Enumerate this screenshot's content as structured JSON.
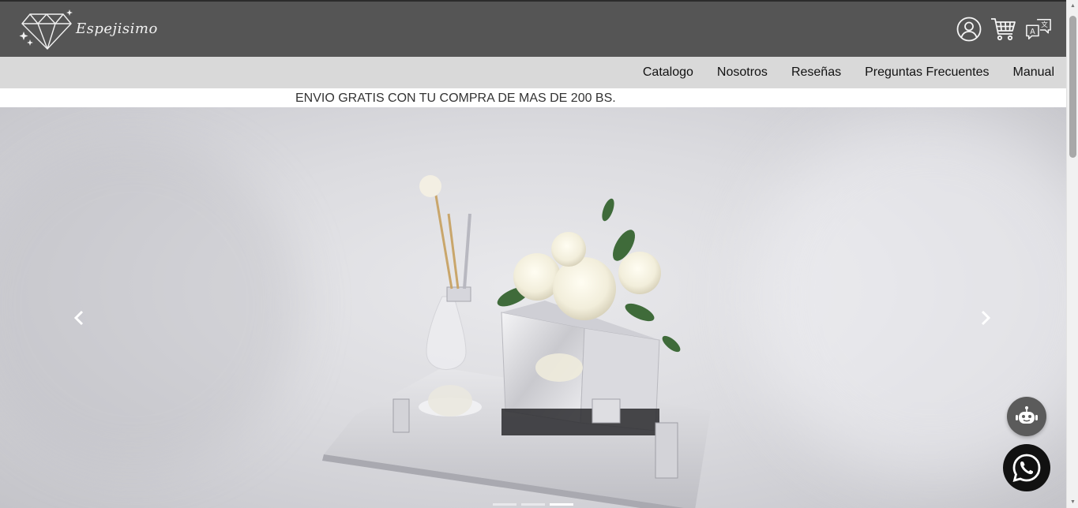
{
  "header": {
    "logo_text": "Espejisimo",
    "icons": [
      "user-account-icon",
      "shopping-cart-icon",
      "translate-icon"
    ]
  },
  "nav": {
    "items": [
      {
        "label": "Catalogo"
      },
      {
        "label": "Nosotros"
      },
      {
        "label": "Reseñas"
      },
      {
        "label": "Preguntas Frecuentes"
      },
      {
        "label": "Manual"
      }
    ]
  },
  "promo": {
    "text": "ENVIO GRATIS CON TU COMPRA DE MAS DE 200 BS."
  },
  "carousel": {
    "slide_count": 3,
    "active_index": 2,
    "prev_icon": "chevron-left-icon",
    "next_icon": "chevron-right-icon"
  },
  "floating": {
    "chatbot_icon": "robot-icon",
    "whatsapp_icon": "whatsapp-icon"
  },
  "colors": {
    "header_bg": "#555555",
    "nav_bg": "#d9d9d9",
    "chatbot_bg": "#5b5b5b",
    "whatsapp_bg": "#111111"
  }
}
